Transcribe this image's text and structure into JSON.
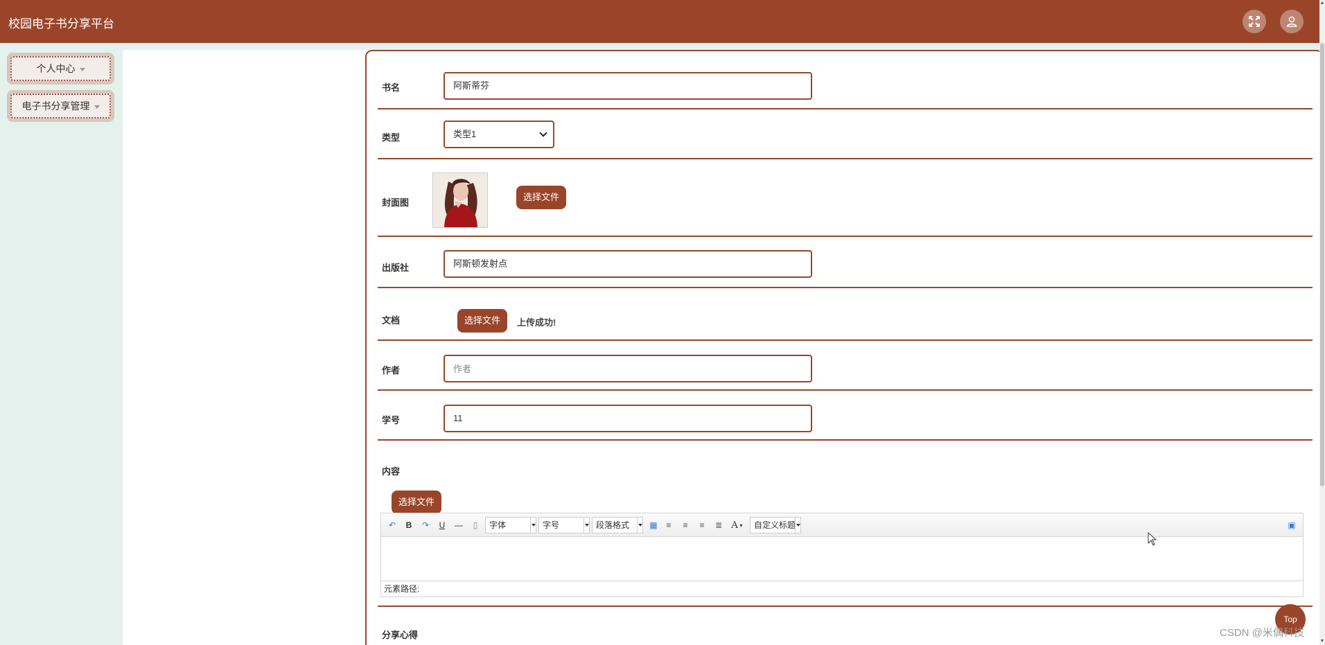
{
  "app": {
    "title": "校园电子书分享平台"
  },
  "header": {
    "fullscreen_icon": "fullscreen-icon",
    "user_icon": "user-icon"
  },
  "sidebar": {
    "items": [
      {
        "label": "个人中心"
      },
      {
        "label": "电子书分享管理"
      }
    ]
  },
  "form": {
    "book_name": {
      "label": "书名",
      "value": "阿斯蒂芬"
    },
    "type": {
      "label": "类型",
      "value": "类型1"
    },
    "cover": {
      "label": "封面图",
      "button": "选择文件"
    },
    "publisher": {
      "label": "出版社",
      "value": "阿斯顿发射点"
    },
    "document": {
      "label": "文档",
      "button": "选择文件",
      "message": "上传成功!"
    },
    "author": {
      "label": "作者",
      "placeholder": "作者"
    },
    "student_id": {
      "label": "学号",
      "value": "11"
    },
    "content": {
      "label": "内容",
      "button": "选择文件",
      "toolbar": {
        "font": "字体",
        "size": "字号",
        "paragraph": "段落格式",
        "font_color": "A",
        "custom_title": "自定义标题",
        "bold": "B",
        "underline": "U"
      },
      "element_path": "元素路径:"
    },
    "share_notes": {
      "label": "分享心得"
    }
  },
  "footer": {
    "top_button": "Top",
    "watermark": "CSDN @米偶科技"
  },
  "colors": {
    "primary": "#9a4529",
    "background": "#e5f1ec"
  }
}
